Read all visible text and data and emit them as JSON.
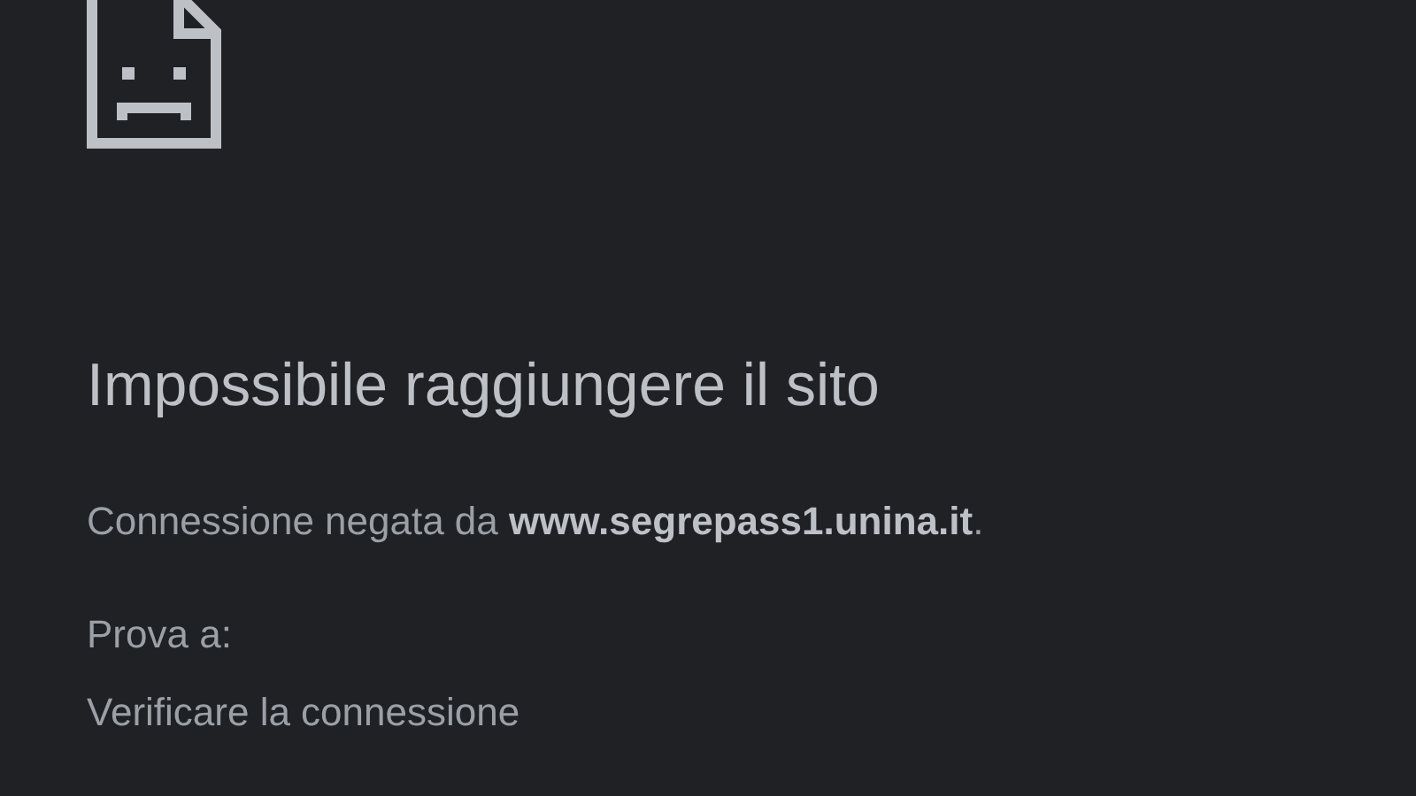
{
  "error": {
    "title": "Impossibile raggiungere il sito",
    "message": "Connessione negata da **www.segrepass1.unina.it**.",
    "try_heading": "Prova a:",
    "suggestions": [
      "Verificare la connessione"
    ]
  }
}
